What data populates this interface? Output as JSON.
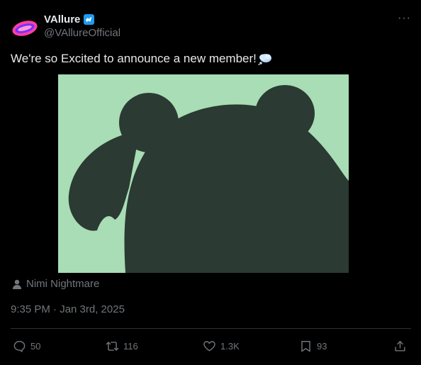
{
  "author": {
    "name": "VAllure",
    "handle": "@VAllureOfficial",
    "avatar_colors": [
      "#ff3fa4",
      "#7b2fff"
    ],
    "verified_color": "#1d9bf0"
  },
  "tweet": {
    "text": "We're so Excited to announce a new member!",
    "emoji_icon": "thought-balloon-icon",
    "media_background": "#a8ddb5",
    "media_silhouette_color": "#2b3a32",
    "tagged_user": "Nimi Nightmare",
    "timestamp": "9:35 PM · Jan 3rd, 2025"
  },
  "actions": {
    "replies": "50",
    "reposts": "116",
    "likes": "1.3K",
    "bookmarks": "93"
  },
  "menu_icon": "more-icon"
}
